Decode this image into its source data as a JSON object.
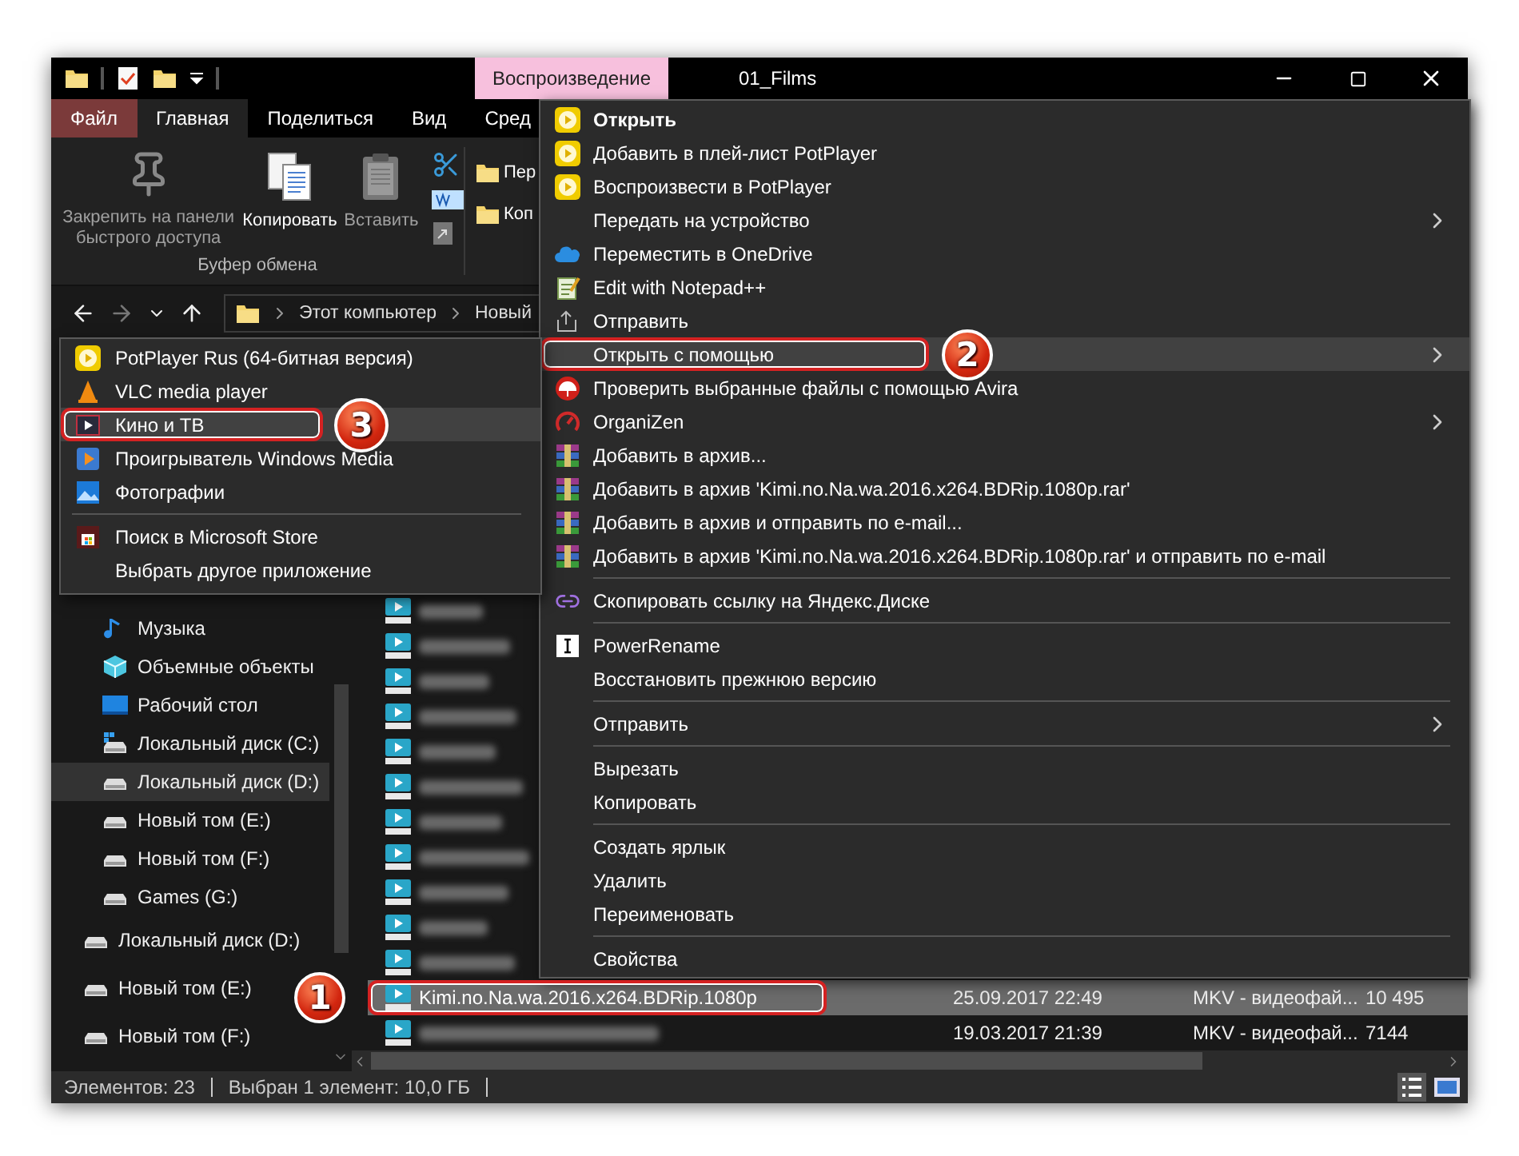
{
  "window": {
    "title": "01_Films",
    "context_tab": "Воспроизведение"
  },
  "ribbon": {
    "tabs": [
      {
        "label": "Файл",
        "kind": "file",
        "selected": false
      },
      {
        "label": "Главная",
        "kind": "tab",
        "selected": true
      },
      {
        "label": "Поделиться",
        "kind": "tab",
        "selected": false
      },
      {
        "label": "Вид",
        "kind": "tab",
        "selected": false
      },
      {
        "label": "Сред",
        "kind": "tab",
        "selected": false
      }
    ],
    "clipboard": {
      "caption": "Буфер обмена",
      "buttons": [
        {
          "label": "Закрепить на панели быстрого доступа",
          "disabled": true
        },
        {
          "label": "Копировать",
          "disabled": false
        },
        {
          "label": "Вставить",
          "disabled": true
        }
      ]
    },
    "organize": {
      "buttons": [
        {
          "label": "Пер"
        },
        {
          "label": "Коп"
        }
      ]
    }
  },
  "address": {
    "crumbs": [
      "Этот компьютер",
      "Новый"
    ]
  },
  "nav": {
    "this_pc": [
      {
        "label": "Музыка",
        "selected": false
      },
      {
        "label": "Объемные объекты",
        "selected": false
      },
      {
        "label": "Рабочий стол",
        "selected": false
      },
      {
        "label": "Локальный диск (C:)",
        "selected": false
      },
      {
        "label": "Локальный диск (D:)",
        "selected": true
      },
      {
        "label": "Новый том (E:)",
        "selected": false
      },
      {
        "label": "Новый том (F:)",
        "selected": false
      },
      {
        "label": "Games (G:)",
        "selected": false
      }
    ],
    "drives": [
      {
        "label": "Локальный диск (D:)",
        "selected": false
      },
      {
        "label": "Новый том (E:)",
        "selected": false
      },
      {
        "label": "Новый том (F:)",
        "selected": false
      }
    ]
  },
  "files": {
    "rows": [
      {
        "blurred": true,
        "selected": false
      },
      {
        "blurred": true,
        "selected": false
      },
      {
        "blurred": true,
        "selected": false
      },
      {
        "blurred": true,
        "selected": false
      },
      {
        "blurred": true,
        "selected": false
      },
      {
        "blurred": true,
        "selected": false
      },
      {
        "blurred": true,
        "selected": false
      },
      {
        "blurred": true,
        "selected": false
      },
      {
        "blurred": true,
        "selected": false
      },
      {
        "blurred": true,
        "selected": false
      },
      {
        "blurred": true,
        "selected": false
      },
      {
        "blurred": false,
        "selected": true,
        "name": "Kimi.no.Na.wa.2016.x264.BDRip.1080p",
        "date": "25.09.2017 22:49",
        "type": "MKV - видеофай...",
        "size": "10 495",
        "callout": "1"
      },
      {
        "blurred": true,
        "selected": false,
        "date": "19.03.2017 21:39",
        "type": "MKV - видеофай...",
        "size": "7144"
      }
    ]
  },
  "status_bar": {
    "count": "Элементов: 23",
    "selection": "Выбран 1 элемент: 10,0 ГБ"
  },
  "context_menu": {
    "items": [
      {
        "kind": "item",
        "label": "Открыть",
        "default": true,
        "submenu": false,
        "selected": false
      },
      {
        "kind": "item",
        "label": "Добавить в плей-лист PotPlayer",
        "default": false,
        "submenu": false,
        "selected": false
      },
      {
        "kind": "item",
        "label": "Воспроизвести в PotPlayer",
        "default": false,
        "submenu": false,
        "selected": false
      },
      {
        "kind": "item",
        "label": "Передать на устройство",
        "default": false,
        "submenu": true,
        "selected": false
      },
      {
        "kind": "item",
        "label": "Переместить в OneDrive",
        "default": false,
        "submenu": false,
        "selected": false
      },
      {
        "kind": "item",
        "label": "Edit with Notepad++",
        "default": false,
        "submenu": false,
        "selected": false
      },
      {
        "kind": "item",
        "label": "Отправить",
        "default": false,
        "submenu": false,
        "selected": false
      },
      {
        "kind": "item",
        "label": "Открыть с помощью",
        "default": false,
        "submenu": true,
        "selected": true,
        "callout": "2"
      },
      {
        "kind": "item",
        "label": "Проверить выбранные файлы с помощью Avira",
        "default": false,
        "submenu": false,
        "selected": false
      },
      {
        "kind": "item",
        "label": "OrganiZen",
        "default": false,
        "submenu": true,
        "selected": false
      },
      {
        "kind": "item",
        "label": "Добавить в архив...",
        "default": false,
        "submenu": false,
        "selected": false
      },
      {
        "kind": "item",
        "label": "Добавить в архив 'Kimi.no.Na.wa.2016.x264.BDRip.1080p.rar'",
        "default": false,
        "submenu": false,
        "selected": false
      },
      {
        "kind": "item",
        "label": "Добавить в архив и отправить по e-mail...",
        "default": false,
        "submenu": false,
        "selected": false
      },
      {
        "kind": "item",
        "label": "Добавить в архив 'Kimi.no.Na.wa.2016.x264.BDRip.1080p.rar' и отправить по e-mail",
        "default": false,
        "submenu": false,
        "selected": false
      },
      {
        "kind": "separator"
      },
      {
        "kind": "item",
        "label": "Скопировать ссылку на Яндекс.Диске",
        "default": false,
        "submenu": false,
        "selected": false
      },
      {
        "kind": "separator"
      },
      {
        "kind": "item",
        "label": "PowerRename",
        "default": false,
        "submenu": false,
        "selected": false
      },
      {
        "kind": "item",
        "label": "Восстановить прежнюю версию",
        "default": false,
        "submenu": false,
        "selected": false
      },
      {
        "kind": "separator"
      },
      {
        "kind": "item",
        "label": "Отправить",
        "default": false,
        "submenu": true,
        "selected": false
      },
      {
        "kind": "separator"
      },
      {
        "kind": "item",
        "label": "Вырезать",
        "default": false,
        "submenu": false,
        "selected": false
      },
      {
        "kind": "item",
        "label": "Копировать",
        "default": false,
        "submenu": false,
        "selected": false
      },
      {
        "kind": "separator"
      },
      {
        "kind": "item",
        "label": "Создать ярлык",
        "default": false,
        "submenu": false,
        "selected": false
      },
      {
        "kind": "item",
        "label": "Удалить",
        "default": false,
        "submenu": false,
        "selected": false
      },
      {
        "kind": "item",
        "label": "Переименовать",
        "default": false,
        "submenu": false,
        "selected": false
      },
      {
        "kind": "separator"
      },
      {
        "kind": "item",
        "label": "Свойства",
        "default": false,
        "submenu": false,
        "selected": false
      }
    ]
  },
  "open_with_menu": {
    "items": [
      {
        "kind": "item",
        "label": "PotPlayer Rus (64-битная версия)",
        "selected": false
      },
      {
        "kind": "item",
        "label": "VLC media player",
        "selected": false
      },
      {
        "kind": "item",
        "label": "Кино и ТВ",
        "selected": true,
        "callout": "3"
      },
      {
        "kind": "item",
        "label": "Проигрыватель Windows Media",
        "selected": false
      },
      {
        "kind": "item",
        "label": "Фотографии",
        "selected": false
      },
      {
        "kind": "separator"
      },
      {
        "kind": "item",
        "label": "Поиск в Microsoft Store",
        "selected": false
      },
      {
        "kind": "item",
        "label": "Выбрать другое приложение",
        "selected": false
      }
    ]
  }
}
